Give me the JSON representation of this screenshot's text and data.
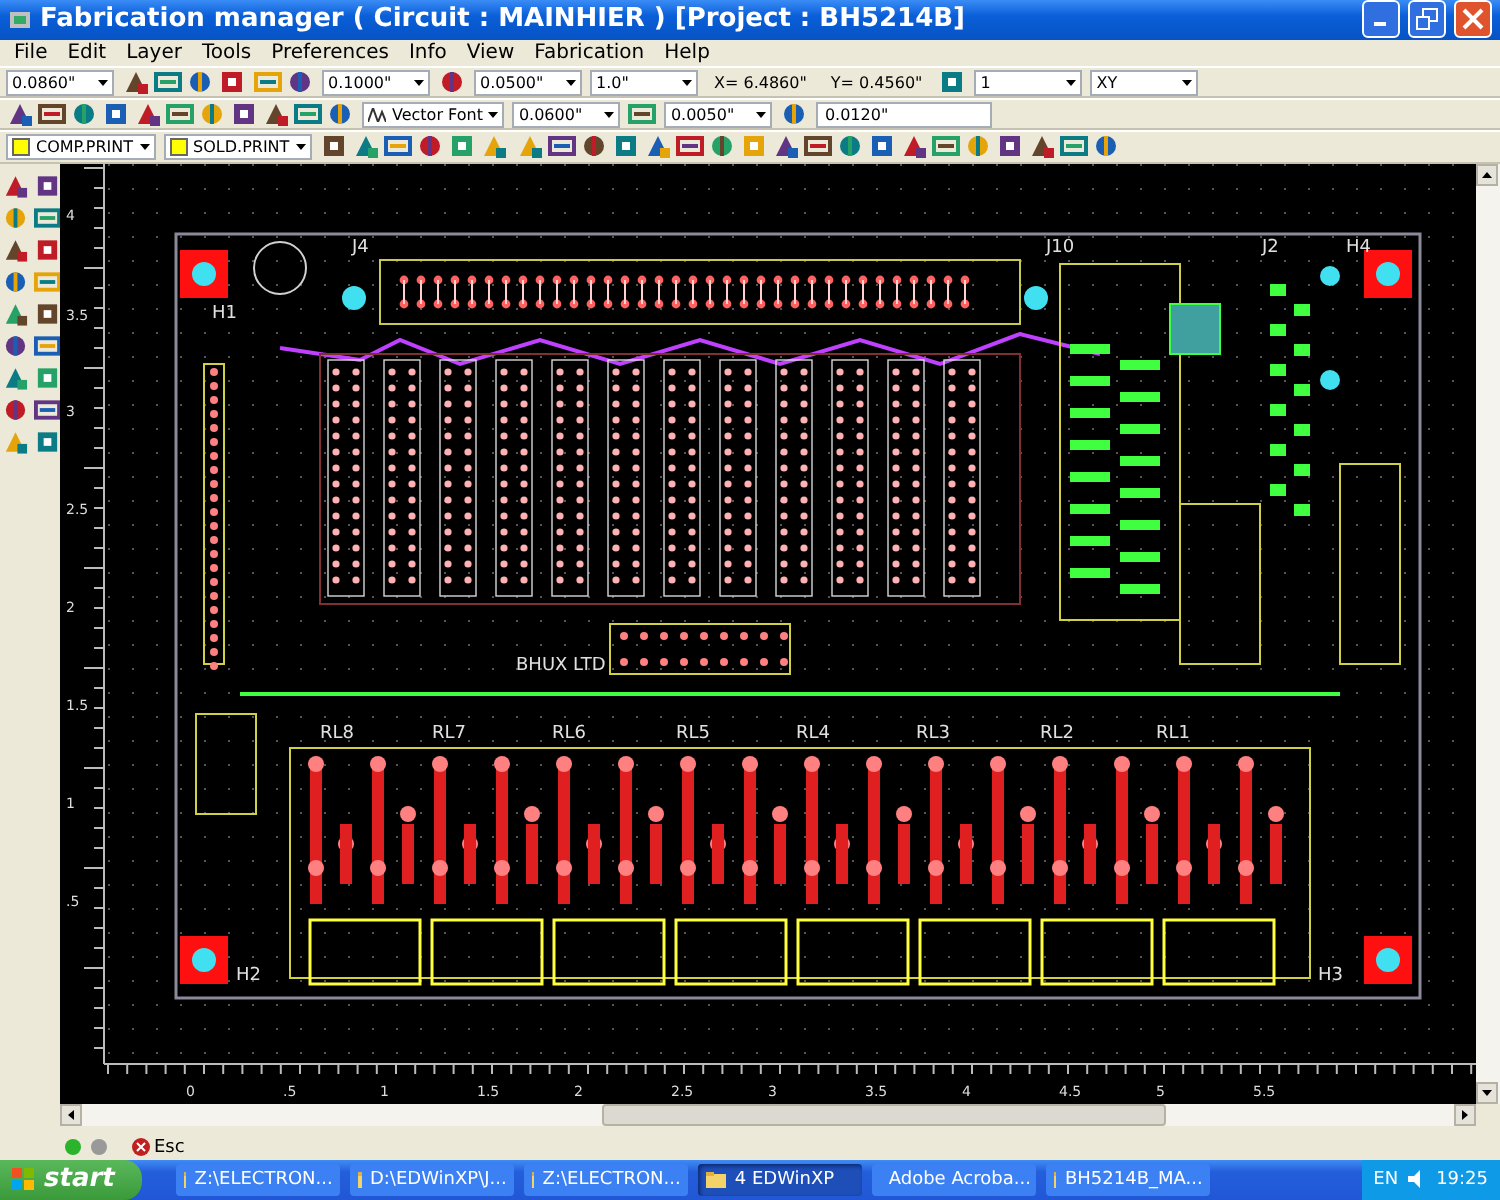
{
  "window": {
    "title": "Fabrication manager ( Circuit : MAINHIER ) [Project : BH5214B]"
  },
  "menu": [
    "File",
    "Edit",
    "Layer",
    "Tools",
    "Preferences",
    "Info",
    "View",
    "Fabrication",
    "Help"
  ],
  "toolbars": [
    [
      {
        "kind": "combo",
        "value": "0.0860\""
      },
      {
        "kind": "icons"
      },
      {
        "kind": "icons"
      },
      {
        "kind": "combo",
        "value": "0.1000\""
      },
      {
        "kind": "icons"
      },
      {
        "kind": "combo",
        "value": "0.0500\""
      },
      {
        "kind": "combo",
        "value": "1.0\""
      },
      {
        "kind": "readout",
        "value": "X= 6.4860\""
      },
      {
        "kind": "readout",
        "value": "Y= 0.4560\""
      },
      {
        "kind": "icons"
      },
      {
        "kind": "combo",
        "value": "1"
      },
      {
        "kind": "combo",
        "value": "XY"
      }
    ],
    [
      {
        "kind": "icons"
      },
      {
        "kind": "font",
        "value": "Vector Font"
      },
      {
        "kind": "combo",
        "value": "0.0600\""
      },
      {
        "kind": "icons"
      },
      {
        "kind": "combo",
        "value": "0.0050\""
      },
      {
        "kind": "icons"
      },
      {
        "kind": "field",
        "value": "0.0120\""
      }
    ],
    [
      {
        "kind": "layer",
        "value": "COMP.PRINT"
      },
      {
        "kind": "layer",
        "value": "SOLD.PRINT"
      },
      {
        "kind": "icons"
      },
      {
        "kind": "icons"
      }
    ]
  ],
  "canvas": {
    "labels": [
      "J4",
      "J10",
      "J2",
      "H4",
      "H1",
      "BHUX LTD",
      "RL8",
      "RL7",
      "RL6",
      "RL5",
      "RL4",
      "RL3",
      "RL2",
      "RL1",
      "H2",
      "H3"
    ],
    "vertical_ruler": [
      "4",
      "3.5",
      "3",
      "2.5",
      "2",
      "1.5",
      "1",
      ".5"
    ],
    "horizontal_ruler": [
      "0",
      ".5",
      "1",
      "1.5",
      "2",
      "2.5",
      "3",
      "3.5",
      "4",
      "4.5",
      "5",
      "5.5"
    ]
  },
  "status_bar": {
    "key": "Esc"
  },
  "taskbar": {
    "start": "start",
    "tasks": [
      {
        "label": "Z:\\ELECTRON...",
        "selected": false
      },
      {
        "label": "D:\\EDWinXP\\J...",
        "selected": false
      },
      {
        "label": "Z:\\ELECTRON...",
        "selected": false
      },
      {
        "label": "4 EDWinXP",
        "selected": true
      },
      {
        "label": "Adobe Acroba...",
        "selected": false
      },
      {
        "label": "BH5214B_MA...",
        "selected": false
      }
    ],
    "language": "EN",
    "clock": "19:25"
  }
}
